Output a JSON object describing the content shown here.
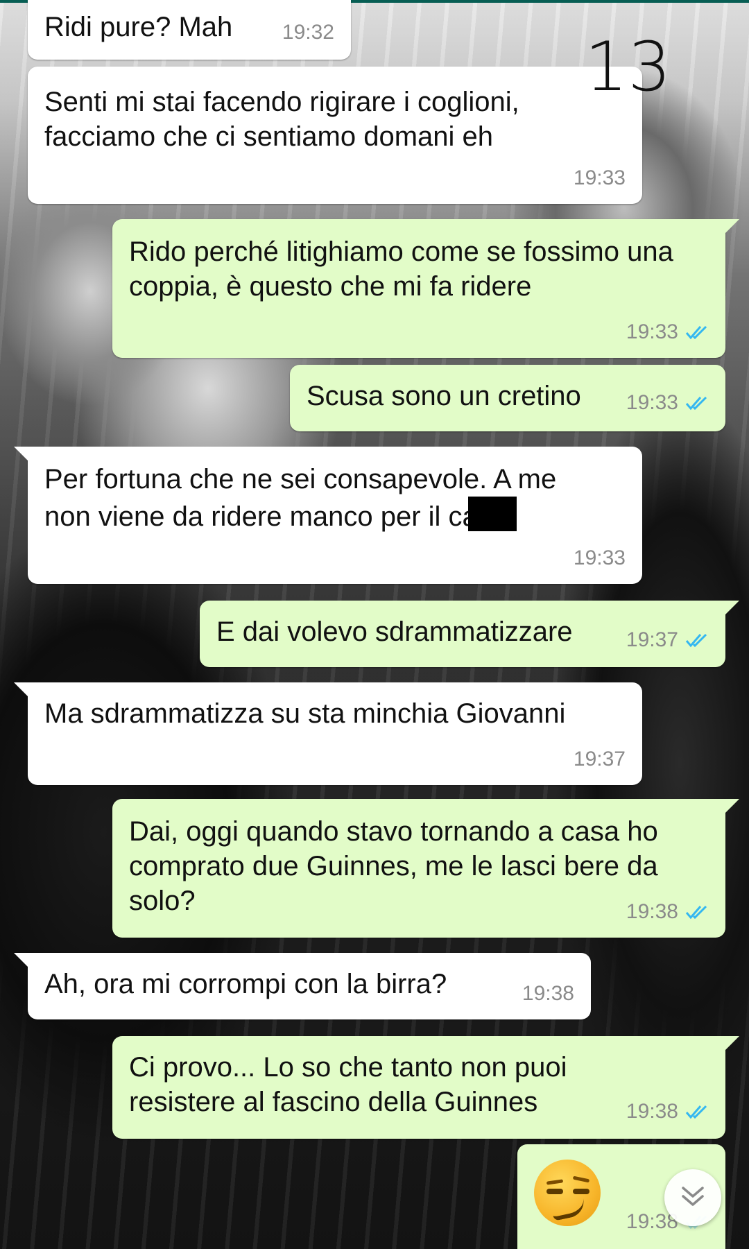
{
  "page_number": "13",
  "messages": [
    {
      "text": "Ridi pure? Mah",
      "time": "19:32",
      "direction": "incoming"
    },
    {
      "text": "Senti mi stai facendo rigirare i coglioni, facciamo che ci sentiamo domani eh",
      "time": "19:33",
      "direction": "incoming"
    },
    {
      "text": "Rido perché litighiamo come se fossimo una coppia, è questo che mi fa ridere",
      "time": "19:33",
      "direction": "outgoing",
      "status": "read"
    },
    {
      "text": "Scusa sono un cretino",
      "time": "19:33",
      "direction": "outgoing",
      "status": "read"
    },
    {
      "text_line1": "Per fortuna che ne sei consapevole. A me",
      "text_line2": "non viene da ridere manco per il ca",
      "time": "19:33",
      "direction": "incoming",
      "redacted": true
    },
    {
      "text": "E dai volevo sdrammatizzare",
      "time": "19:37",
      "direction": "outgoing",
      "status": "read"
    },
    {
      "text": "Ma sdrammatizza su sta minchia Giovanni",
      "time": "19:37",
      "direction": "incoming"
    },
    {
      "text": "Dai, oggi quando stavo tornando a casa ho comprato due Guinnes, me le lasci bere da solo?",
      "time": "19:38",
      "direction": "outgoing",
      "status": "read"
    },
    {
      "text": "Ah, ora mi corrompi con la birra?",
      "time": "19:38",
      "direction": "incoming"
    },
    {
      "text": "Ci provo... Lo so che tanto non puoi resistere al fascino della Guinnes",
      "time": "19:38",
      "direction": "outgoing",
      "status": "read"
    },
    {
      "emoji": "smirking-face-emoji",
      "time": "19:38",
      "direction": "outgoing",
      "status": "read"
    }
  ],
  "colors": {
    "incoming_bubble": "#ffffff",
    "outgoing_bubble": "#e2fcc8",
    "read_ticks": "#34b7f1",
    "timestamp": "#8a8a8a"
  },
  "icons": {
    "read_receipt": "double-check-icon",
    "scroll_down": "double-chevron-down-icon"
  }
}
